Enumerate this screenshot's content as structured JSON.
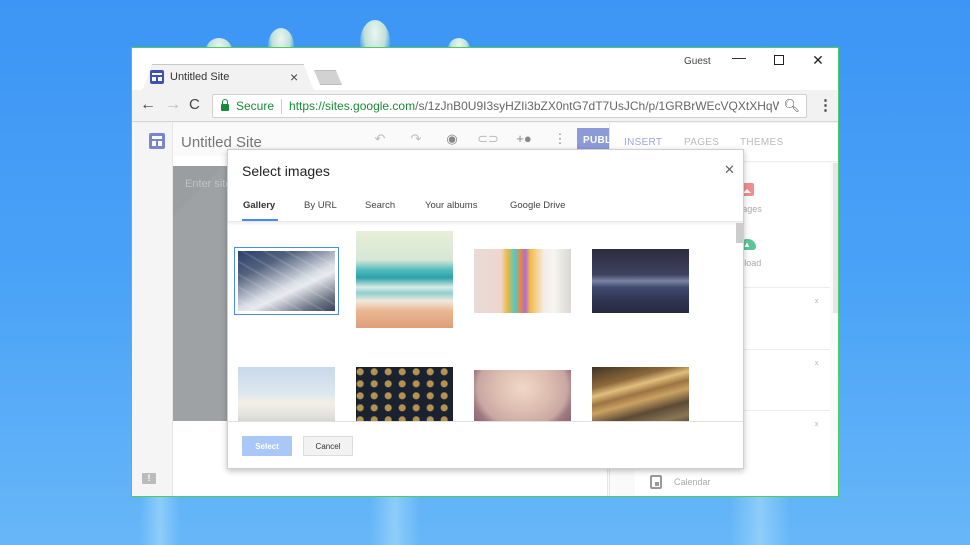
{
  "browser": {
    "tab_title": "Untitled Site",
    "profile_label": "Guest",
    "omnibox": {
      "secure_label": "Secure",
      "url_scheme_host": "https://sites.google.com",
      "url_path": "/s/1zJnB0U9I3syHZIi3bZX0ntG7dT7UsJCh/p/1GRBrWEcVQXtXHqW..."
    }
  },
  "editor": {
    "site_title": "Untitled Site",
    "header_placeholder": "Enter site title",
    "publish_label": "PUBLISH",
    "toolbar_icons": [
      "undo-icon",
      "redo-icon",
      "preview-icon",
      "link-icon",
      "share-icon",
      "more-icon"
    ]
  },
  "right_panel": {
    "tabs": [
      {
        "label": "INSERT",
        "active": true
      },
      {
        "label": "PAGES",
        "active": false
      },
      {
        "label": "THEMES",
        "active": false
      }
    ],
    "insert_items": [
      {
        "label": "Images",
        "icon": "image-icon"
      },
      {
        "label": "Upload",
        "icon": "upload-icon"
      }
    ],
    "bottom_item": {
      "label": "Calendar",
      "icon": "calendar-icon"
    }
  },
  "dialog": {
    "title": "Select images",
    "tabs": [
      {
        "label": "Gallery",
        "active": true
      },
      {
        "label": "By URL",
        "active": false
      },
      {
        "label": "Search",
        "active": false
      },
      {
        "label": "Your albums",
        "active": false
      },
      {
        "label": "Google Drive",
        "active": false
      }
    ],
    "images": [
      {
        "name": "abstract-stripes-blue",
        "selected": true
      },
      {
        "name": "beach-waves",
        "selected": false
      },
      {
        "name": "sticky-notes",
        "selected": false
      },
      {
        "name": "night-lake",
        "selected": false
      },
      {
        "name": "clouds-horizon",
        "selected": false
      },
      {
        "name": "typewriter-keys",
        "selected": false
      },
      {
        "name": "pink-sunset-sea",
        "selected": false
      },
      {
        "name": "motion-blur-gold",
        "selected": false
      }
    ],
    "select_label": "Select",
    "cancel_label": "Cancel"
  },
  "colors": {
    "accent_blue": "#4a8af4",
    "publish": "#8c9ad8",
    "secure_green": "#1a8a3a",
    "window_border": "#4ccf5a"
  }
}
